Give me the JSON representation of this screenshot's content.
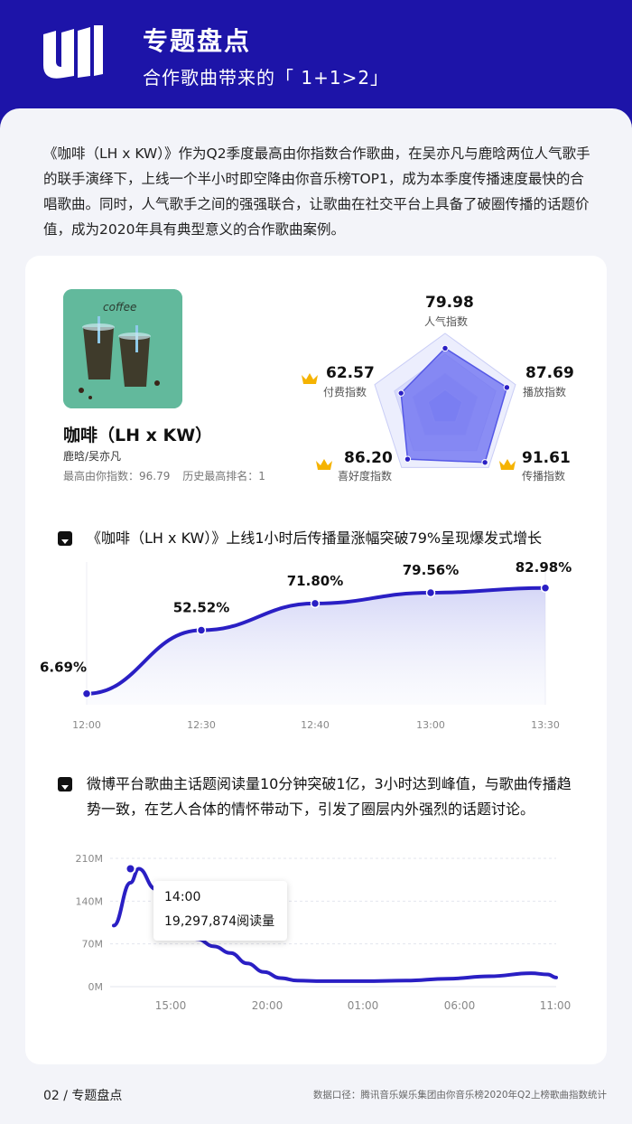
{
  "header": {
    "title": "专题盘点",
    "subtitle": "合作歌曲带来的「 1+1>2」"
  },
  "intro": "《咖啡（LH x KW）》作为Q2季度最高由你指数合作歌曲，在吴亦凡与鹿晗两位人气歌手的联手演绎下，上线一个半小时即空降由你音乐榜TOP1，成为本季度传播速度最快的合唱歌曲。同时，人气歌手之间的强强联合，让歌曲在社交平台上具备了破圈传播的话题价值，成为2020年具有典型意义的合作歌曲案例。",
  "song": {
    "cover_text": "coffee",
    "title": "咖啡（LH x KW）",
    "artists": "鹿晗/吴亦凡",
    "max_index": "最高由你指数：96.79",
    "history_rank": "历史最高排名：1"
  },
  "radar": {
    "metrics": [
      {
        "label": "人气指数",
        "value": 79.98,
        "value_text": "79.98",
        "crown": false
      },
      {
        "label": "播放指数",
        "value": 87.69,
        "value_text": "87.69",
        "crown": false
      },
      {
        "label": "传播指数",
        "value": 91.61,
        "value_text": "91.61",
        "crown": true
      },
      {
        "label": "喜好度指数",
        "value": 86.2,
        "value_text": "86.20",
        "crown": true
      },
      {
        "label": "付费指数",
        "value": 62.57,
        "value_text": "62.57",
        "crown": true
      }
    ],
    "fill_color": "#6a6cf0",
    "crown_color": "#f5b301"
  },
  "section1": {
    "title": "《咖啡（LH x KW）》上线1小时后传播量涨幅突破79%呈现爆发式增长"
  },
  "section2": {
    "title": "微博平台歌曲主话题阅读量10分钟突破1亿，3小时达到峰值，与歌曲传播趋势一致，在艺人合体的情怀带动下，引发了圈层内外强烈的话题讨论。"
  },
  "tooltip": {
    "time": "14:00",
    "value": "19,297,874阅读量"
  },
  "chart_data": [
    {
      "type": "area",
      "categories": [
        "12:00",
        "12:30",
        "12:40",
        "13:00",
        "13:30"
      ],
      "values": [
        6.69,
        52.52,
        71.8,
        79.56,
        82.98
      ],
      "data_labels": [
        "6.69%",
        "52.52%",
        "71.80%",
        "79.56%",
        "82.98%"
      ],
      "color": "#2a1fc4"
    },
    {
      "type": "line",
      "x_ticks": [
        "15:00",
        "20:00",
        "01:00",
        "06:00",
        "11:00"
      ],
      "y_ticks": [
        "210M",
        "140M",
        "70M",
        "0M"
      ],
      "ylim": [
        0,
        210
      ],
      "x": [
        0,
        2,
        3,
        5,
        6,
        8,
        10,
        12,
        14,
        16,
        18,
        20,
        22,
        25,
        30,
        35,
        40,
        45,
        50,
        52,
        53
      ],
      "values": [
        100,
        170,
        193,
        160,
        120,
        95,
        78,
        66,
        55,
        38,
        24,
        14,
        10,
        9,
        9,
        10,
        13,
        17,
        22,
        20,
        15
      ],
      "highlight": {
        "x": 2,
        "value": 193
      },
      "color": "#2a1fc4"
    }
  ],
  "footer": {
    "page": "02 / 专题盘点",
    "source": "数据口径：腾讯音乐娱乐集团由你音乐榜2020年Q2上榜歌曲指数统计"
  }
}
